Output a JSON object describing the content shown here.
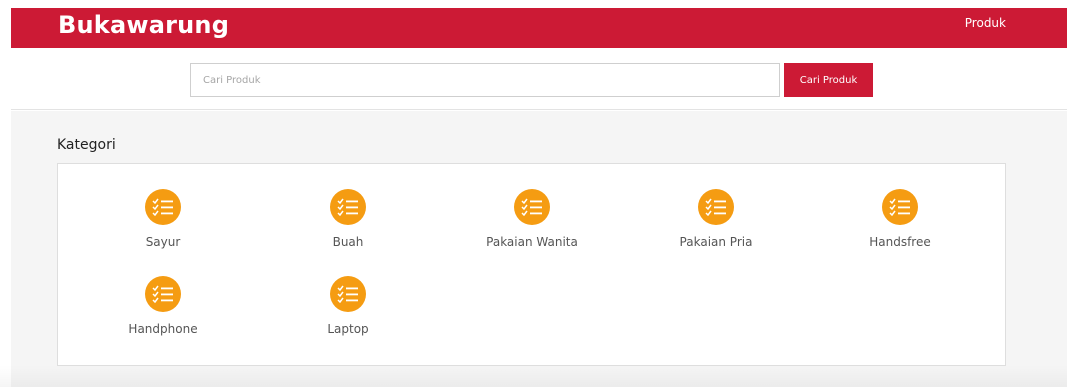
{
  "navbar": {
    "brand": "Bukawarung",
    "links": [
      "Produk"
    ],
    "color": "#cc1a35"
  },
  "search": {
    "placeholder": "Cari Produk",
    "value": "",
    "button_label": "Cari Produk"
  },
  "categories": {
    "title": "Kategori",
    "icon": "checklist-icon",
    "icon_color": "#f59c12",
    "items": [
      {
        "label": "Sayur"
      },
      {
        "label": "Buah"
      },
      {
        "label": "Pakaian Wanita"
      },
      {
        "label": "Pakaian Pria"
      },
      {
        "label": "Handsfree"
      },
      {
        "label": "Handphone"
      },
      {
        "label": "Laptop"
      }
    ]
  }
}
